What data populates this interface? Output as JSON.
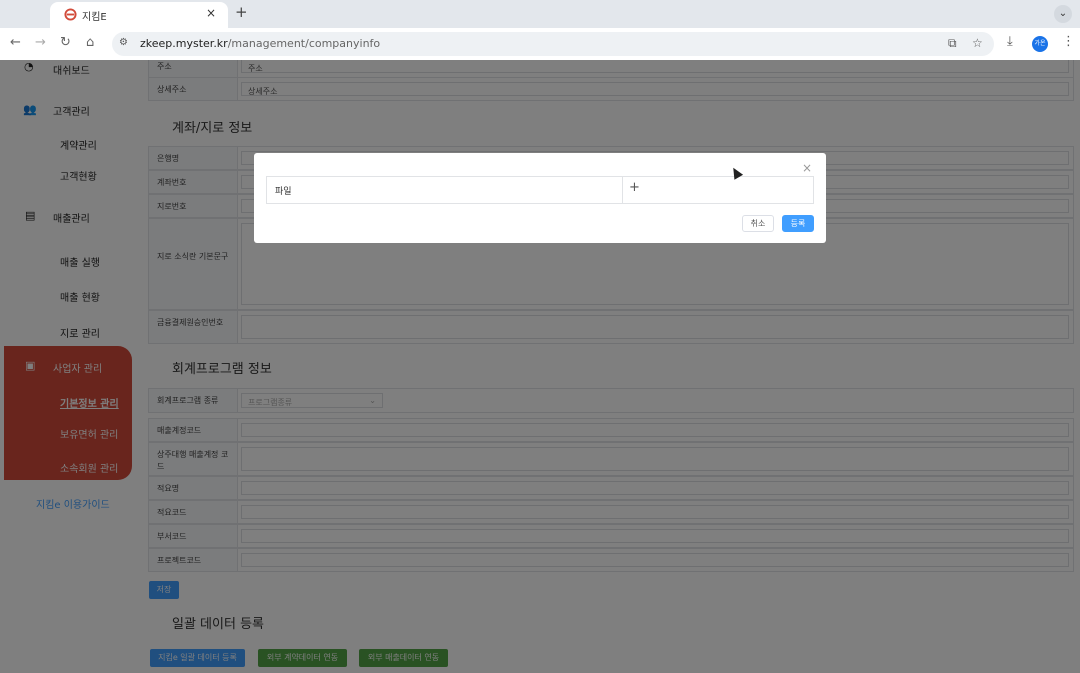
{
  "browser": {
    "tab_title": "지킴E",
    "tab_close": "×",
    "new_tab": "+",
    "tab_menu": "⌄",
    "back": "←",
    "forward": "→",
    "reload": "↻",
    "home": "⌂",
    "url_host": "zkeep.myster.kr",
    "url_path": "/management/companyinfo",
    "profile": "가온"
  },
  "sidebar": {
    "items": [
      {
        "label": "대쉬보드"
      },
      {
        "label": "고객관리"
      },
      {
        "label": "계약관리"
      },
      {
        "label": "고객현황"
      },
      {
        "label": "매출관리"
      },
      {
        "label": "매출 실행"
      },
      {
        "label": "매출 현황"
      },
      {
        "label": "지로 관리"
      },
      {
        "label": "사업자 관리"
      },
      {
        "label": "기본정보 관리"
      },
      {
        "label": "보유면허 관리"
      },
      {
        "label": "소속회원 관리"
      },
      {
        "label": "지킴e 이용가이드"
      }
    ]
  },
  "form": {
    "address_label": "주소",
    "address_value": "주소",
    "detail_address_label": "상세주소",
    "detail_address_value": "상세주소",
    "account_section": "계좌/지로 정보",
    "bank_label": "은행명",
    "account_label": "계좌번호",
    "giro_label": "지로번호",
    "giro_note_label": "지로 소식란 기본문구",
    "finance_label": "금융결제원승인번호",
    "accounting_section": "회계프로그램 정보",
    "program_type_label": "회계프로그램 종류",
    "program_type_placeholder": "프로그램종류",
    "sales_code_label": "매출계정코드",
    "regular_sales_code_label": "상주대행 매출계정 코드",
    "summary_label": "적요명",
    "summary_code_label": "적요코드",
    "dept_code_label": "부서코드",
    "project_code_label": "프로젝트코드",
    "save_button": "저장",
    "bulk_section": "일괄 데이터 등록",
    "bulk_btn1": "지킴e 일괄 데이터 등록",
    "bulk_btn2": "외부 계약데이터 연동",
    "bulk_btn3": "외부 매출데이터 연동"
  },
  "modal": {
    "file_label": "파일",
    "add": "+",
    "close": "×",
    "cancel": "취소",
    "register": "등록"
  },
  "colors": {
    "sidebar_active": "#d24b3a",
    "primary": "#409eff",
    "green": "#52a446"
  }
}
